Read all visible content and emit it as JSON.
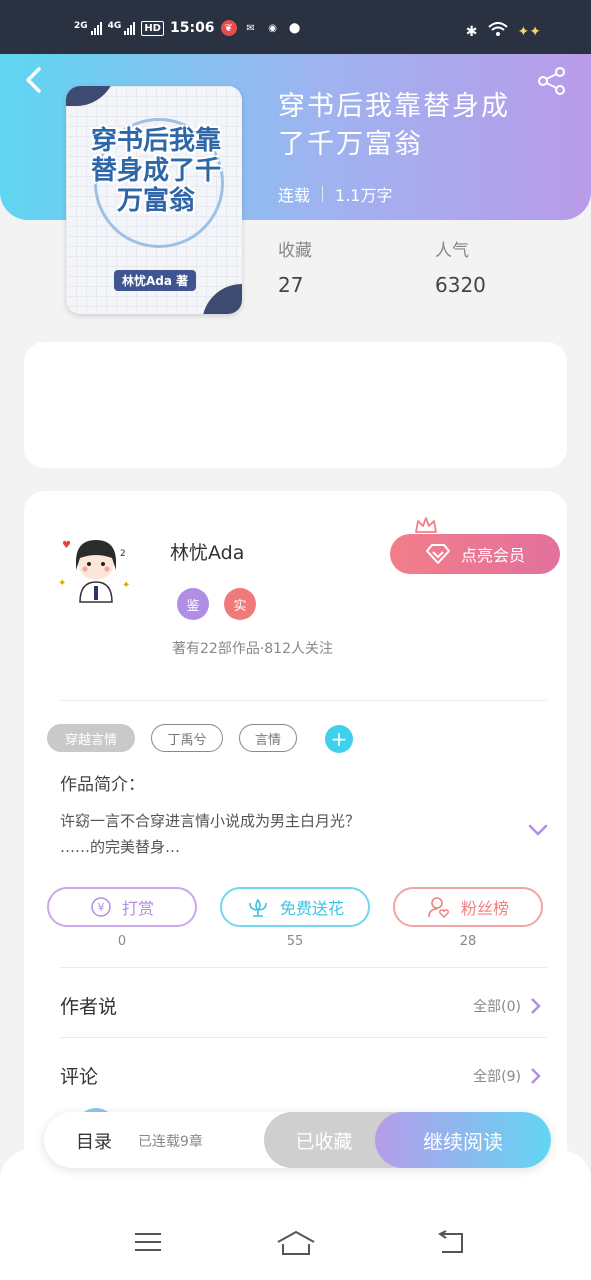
{
  "status_bar": {
    "signal1": "2G",
    "signal2": "4G",
    "hd": "HD",
    "time": "15:06"
  },
  "book": {
    "title": "穿书后我靠替身成了千万富翁",
    "status": "连载",
    "word_count": "1.1万字",
    "favorites_label": "收藏",
    "favorites_value": "27",
    "popularity_label": "人气",
    "popularity_value": "6320",
    "cover": {
      "title_art": "穿书后我靠替身成了千万富翁",
      "author_tag": "林忧Ada 著"
    }
  },
  "author": {
    "name": "林忧Ada",
    "badge1": "鉴",
    "badge2": "实",
    "stats": "著有22部作品·812人关注",
    "vip_button": "点亮会员"
  },
  "tags": [
    "穿越言情",
    "丁禹兮",
    "言情"
  ],
  "intro": {
    "label": "作品简介：",
    "line1": "许窈一言不合穿进言情小说成为男主白月光？",
    "line2": "……的完美替身…"
  },
  "actions": [
    {
      "label": "打赏",
      "count": "0"
    },
    {
      "label": "免费送花",
      "count": "55"
    },
    {
      "label": "粉丝榜",
      "count": "28"
    }
  ],
  "author_says": {
    "label": "作者说",
    "link": "全部(0)"
  },
  "comments": {
    "label": "评论",
    "link": "全部(9)"
  },
  "bottom_bar": {
    "catalog": "目录",
    "chapters": "已连载9章",
    "favorited": "已收藏",
    "continue": "继续阅读"
  },
  "colors": {
    "header_start": "#5fd6f2",
    "header_end": "#b99bea",
    "vip": "#f27e89",
    "purple": "#b08ee6",
    "cyan": "#3fd0ec"
  }
}
